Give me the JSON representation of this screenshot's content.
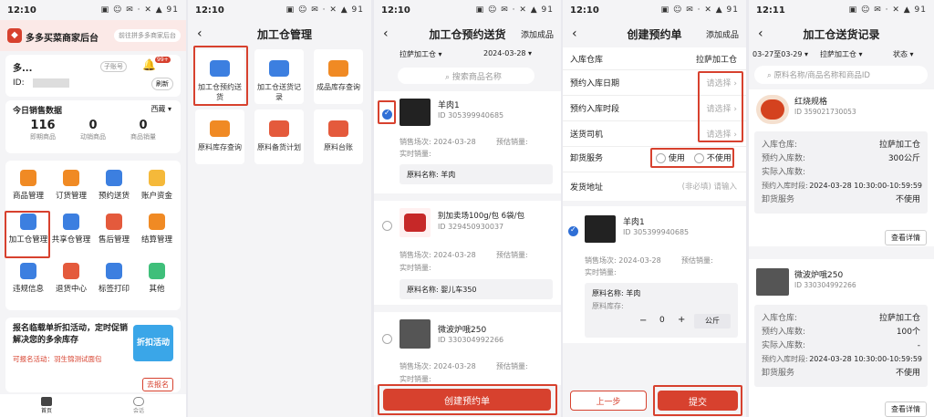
{
  "status_time1": "12:10",
  "status_time2": "12:10",
  "status_time3": "12:10",
  "status_time4": "12:10",
  "status_time5": "12:11",
  "p1": {
    "app_title": "多多买菜商家后台",
    "switch_label": "前往拼多多商家后台",
    "user_name": "多...",
    "sub_account": "子账号",
    "id_label": "ID:",
    "refresh": "刷新",
    "badge": "99+",
    "today_sales": "今日销售数据",
    "region": "西藏",
    "stats": [
      {
        "value": "116",
        "label": "即期商品"
      },
      {
        "value": "0",
        "label": "动销商品"
      },
      {
        "value": "0",
        "label": "商品销量"
      }
    ],
    "menu": [
      "商品管理",
      "订货管理",
      "预约送货",
      "账户资金",
      "加工仓管理",
      "共享仓管理",
      "售后管理",
      "结算管理",
      "违规信息",
      "退货中心",
      "标签打印",
      "其他"
    ],
    "promo_text": "报名临载单折扣活动，定时促销解决您的多余库存",
    "promo_sub": "可报名活动：羽生锦测试面包",
    "promo_badge": "折扣活动",
    "promo_btn": "去报名",
    "nav_home": "首页",
    "nav_msg": "会话"
  },
  "p2": {
    "title": "加工仓管理",
    "tiles": [
      "加工仓预约送货",
      "加工仓送货记录",
      "成品库存查询",
      "原料库存查询",
      "原料备货计划",
      "原料台账"
    ]
  },
  "p3": {
    "title": "加工仓预约送货",
    "right": "添加成品",
    "warehouse": "拉萨加工仓",
    "date": "2024-03-28",
    "search_ph": "搜索商品名称",
    "items": [
      {
        "name": "羊肉1",
        "id": "ID 305399940685",
        "sale_label": "销售场次: 2024-03-28",
        "pre_label": "预估销量:",
        "real_label": "实时销量:",
        "raw": "原料名称:  羊肉"
      },
      {
        "name": "别加卖场100g/包 6袋/包",
        "id": "ID 329450930037",
        "sale_label": "销售场次: 2024-03-28",
        "pre_label": "预估销量:",
        "real_label": "实时销量:",
        "raw": "原料名称:  婴儿车350"
      },
      {
        "name": "微波炉哦250",
        "id": "ID 330304992266",
        "sale_label": "销售场次: 2024-03-28",
        "pre_label": "预估销量:",
        "real_label": "实时销量:"
      }
    ],
    "submit": "创建预约单"
  },
  "p4": {
    "title": "创建预约单",
    "right": "添加成品",
    "rows": [
      {
        "label": "入库仓库",
        "value": "拉萨加工仓"
      },
      {
        "label": "预约入库日期",
        "value": "请选择"
      },
      {
        "label": "预约入库时段",
        "value": "请选择"
      },
      {
        "label": "送货司机",
        "value": "请选择"
      }
    ],
    "unload_label": "卸货服务",
    "use": "使用",
    "nouse": "不使用",
    "addr_label": "发货地址",
    "addr_ph": "(非必填) 请输入",
    "item": {
      "name": "羊肉1",
      "id": "ID 305399940685",
      "sale": "销售场次: 2024-03-28",
      "pre": "预估销量:",
      "real": "实时销量:",
      "raw": "原料名称:  羊肉",
      "stock": "原料库存:",
      "qty": "0",
      "unit": "公斤"
    },
    "prev": "上一步",
    "submit": "提交"
  },
  "p5": {
    "title": "加工仓送货记录",
    "date_range": "03-27至03-29",
    "warehouse": "拉萨加工仓",
    "status": "状态",
    "search_ph": "原料名称/商品名称和商品ID",
    "records": [
      {
        "name": "红烧规格",
        "id": "ID 359021730053",
        "fields": [
          [
            "入库仓库:",
            "拉萨加工仓"
          ],
          [
            "预约入库数:",
            "300公斤"
          ],
          [
            "实际入库数:",
            ""
          ],
          [
            "预约入库时段:",
            "2024-03-28 10:30:00-10:59:59"
          ],
          [
            "卸货服务",
            "不使用"
          ]
        ],
        "btn": "查看详情"
      },
      {
        "name": "微波炉哦250",
        "id": "ID 330304992266",
        "fields": [
          [
            "入库仓库:",
            "拉萨加工仓"
          ],
          [
            "预约入库数:",
            "100个"
          ],
          [
            "实际入库数:",
            "-"
          ],
          [
            "预约入库时段:",
            "2024-03-28 10:30:00-10:59:59"
          ],
          [
            "卸货服务",
            "不使用"
          ]
        ],
        "btn": "查看详情"
      }
    ]
  },
  "colors": {
    "accent": "#d7412e",
    "blue": "#2f6fd6"
  }
}
